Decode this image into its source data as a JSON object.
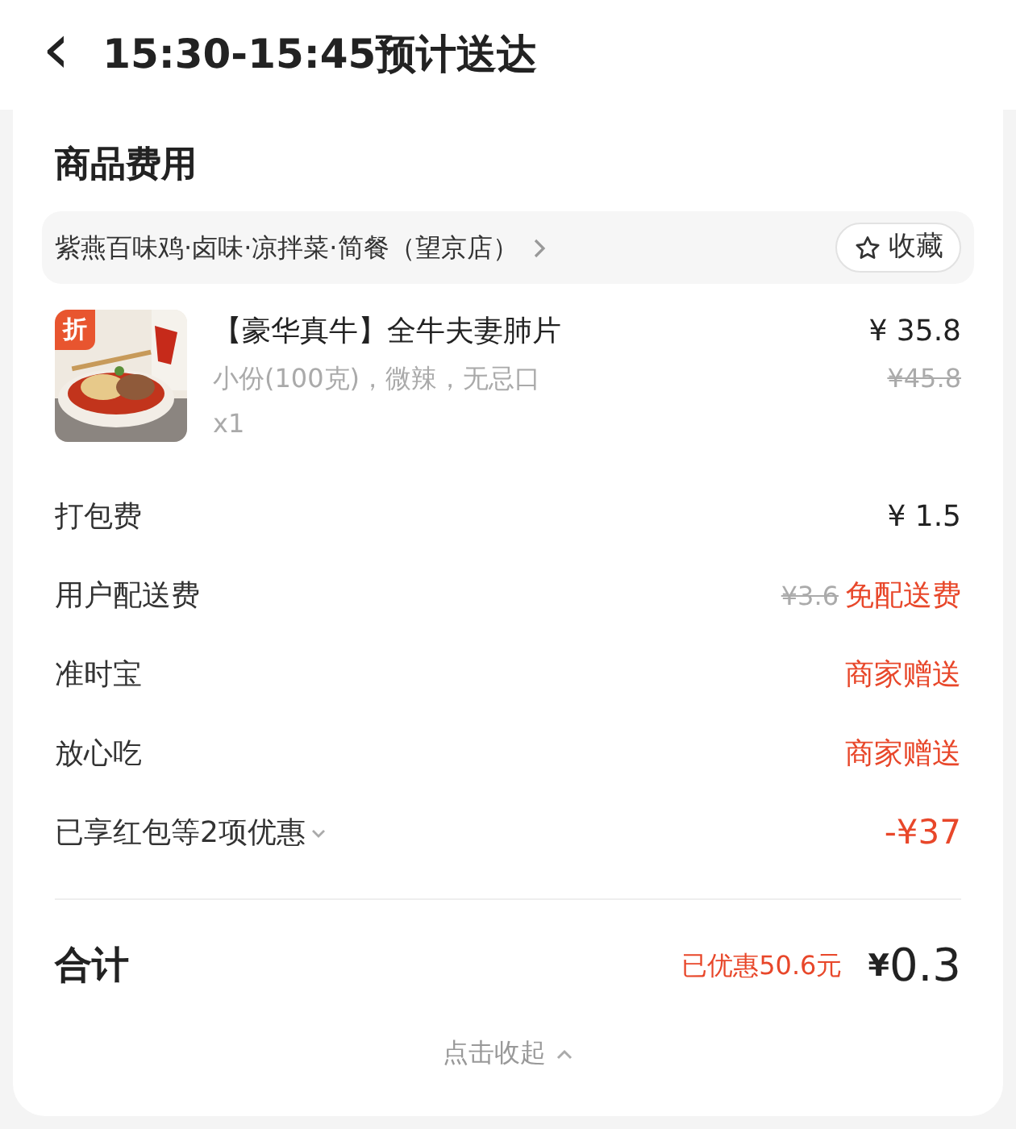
{
  "header": {
    "back": "‹",
    "title": "15:30-15:45预计送达"
  },
  "card": {
    "title": "商品费用",
    "store": {
      "name": "紫燕百味鸡·卤味·凉拌菜·简餐（望京店）",
      "favorite": "收藏"
    },
    "item": {
      "badge": "折",
      "name": "【豪华真牛】全牛夫妻肺片",
      "spec": "小份(100克)，微辣，无忌口",
      "qty": "x1",
      "price": "¥ 35.8",
      "original_price": "¥45.8"
    },
    "fees": [
      {
        "kind": "normal",
        "label": "打包费",
        "value": "¥ 1.5"
      },
      {
        "kind": "free",
        "label": "用户配送费",
        "original": "¥3.6",
        "value": "免配送费"
      },
      {
        "kind": "promo",
        "label": "准时宝",
        "value": "商家赠送"
      },
      {
        "kind": "promo",
        "label": "放心吃",
        "value": "商家赠送"
      },
      {
        "kind": "discount",
        "label": "已享红包等2项优惠",
        "value": "-¥37"
      }
    ],
    "total": {
      "label": "合计",
      "saved": "已优惠50.6元",
      "currency": "¥",
      "amount": "0.3"
    },
    "collapse": "点击收起"
  }
}
